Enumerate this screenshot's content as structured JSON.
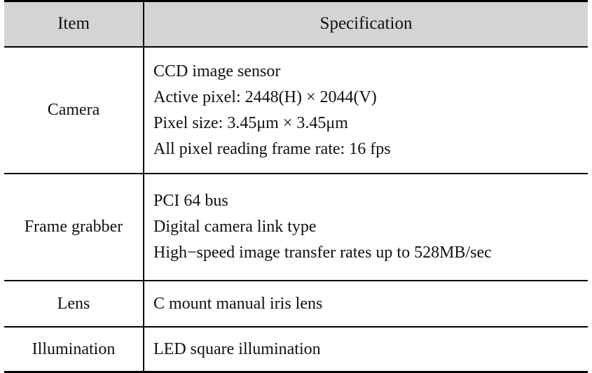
{
  "table": {
    "columns": [
      {
        "key": "item",
        "label": "Item"
      },
      {
        "key": "specification",
        "label": "Specification"
      }
    ],
    "header_background": "#d4d4d4",
    "rule_color": "#000000",
    "rows": [
      {
        "item": "Camera",
        "spec_lines": [
          "CCD image sensor",
          "Active pixel: 2448(H) × 2044(V)",
          "Pixel size: 3.45μm × 3.45μm",
          "All pixel reading frame rate: 16 fps"
        ]
      },
      {
        "item": "Frame grabber",
        "spec_lines": [
          "PCI 64 bus",
          "Digital camera link type",
          "High−speed image transfer rates up to 528MB/sec"
        ]
      },
      {
        "item": "Lens",
        "spec_lines": [
          "C mount manual iris lens"
        ]
      },
      {
        "item": "Illumination",
        "spec_lines": [
          "LED square illumination"
        ]
      }
    ]
  }
}
